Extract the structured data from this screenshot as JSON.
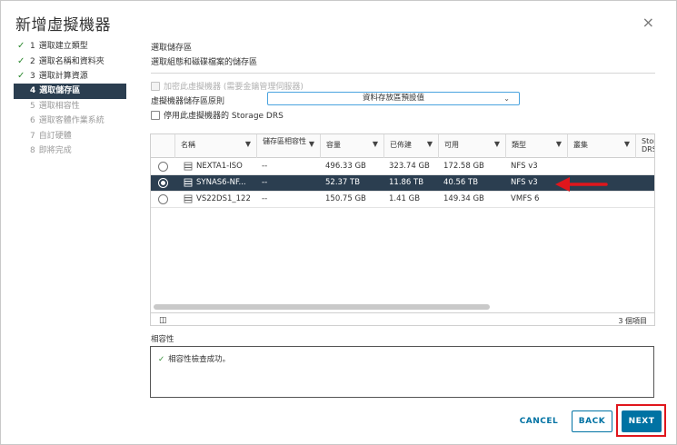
{
  "dialog": {
    "title": "新增虛擬機器",
    "close_glyph": "×"
  },
  "steps": [
    {
      "num": "1",
      "label": "選取建立類型",
      "state": "done"
    },
    {
      "num": "2",
      "label": "選取名稱和資料夾",
      "state": "done"
    },
    {
      "num": "3",
      "label": "選取計算資源",
      "state": "done"
    },
    {
      "num": "4",
      "label": "選取儲存區",
      "state": "active"
    },
    {
      "num": "5",
      "label": "選取相容性",
      "state": "future"
    },
    {
      "num": "6",
      "label": "選取客體作業系統",
      "state": "future"
    },
    {
      "num": "7",
      "label": "自訂硬體",
      "state": "future"
    },
    {
      "num": "8",
      "label": "即將完成",
      "state": "future"
    }
  ],
  "main": {
    "heading": "選取儲存區",
    "subheading": "選取組態和磁碟檔案的儲存區",
    "encrypt_label": "加密此虛擬機器 (需要金鑰管理伺服器)",
    "policy_label": "虛擬機器儲存區原則",
    "policy_value": "資料存放區預設值",
    "drs_label": "停用此虛擬機器的 Storage DRS"
  },
  "table": {
    "columns": [
      "名稱",
      "儲存區相容性",
      "容量",
      "已佈建",
      "可用",
      "類型",
      "叢集",
      "Storage DRS"
    ],
    "rows": [
      {
        "name": "NEXTA1-ISO",
        "compat": "--",
        "capacity": "496.33 GB",
        "provisioned": "323.74 GB",
        "free": "172.58 GB",
        "type": "NFS v3",
        "cluster": "",
        "selected": false
      },
      {
        "name": "SYNAS6-NF...",
        "compat": "--",
        "capacity": "52.37 TB",
        "provisioned": "11.86 TB",
        "free": "40.56 TB",
        "type": "NFS v3",
        "cluster": "",
        "selected": true
      },
      {
        "name": "VS22DS1_122",
        "compat": "--",
        "capacity": "150.75 GB",
        "provisioned": "1.41 GB",
        "free": "149.34 GB",
        "type": "VMFS 6",
        "cluster": "",
        "selected": false
      }
    ],
    "item_count": "3 個項目"
  },
  "compat": {
    "label": "相容性",
    "message": "相容性檢查成功。"
  },
  "buttons": {
    "cancel": "CANCEL",
    "back": "BACK",
    "next": "NEXT"
  },
  "colors": {
    "accent": "#0072a3",
    "selected_row": "#2b3e50",
    "check_green": "#2f8a32",
    "annotation_red": "#e0161c"
  }
}
